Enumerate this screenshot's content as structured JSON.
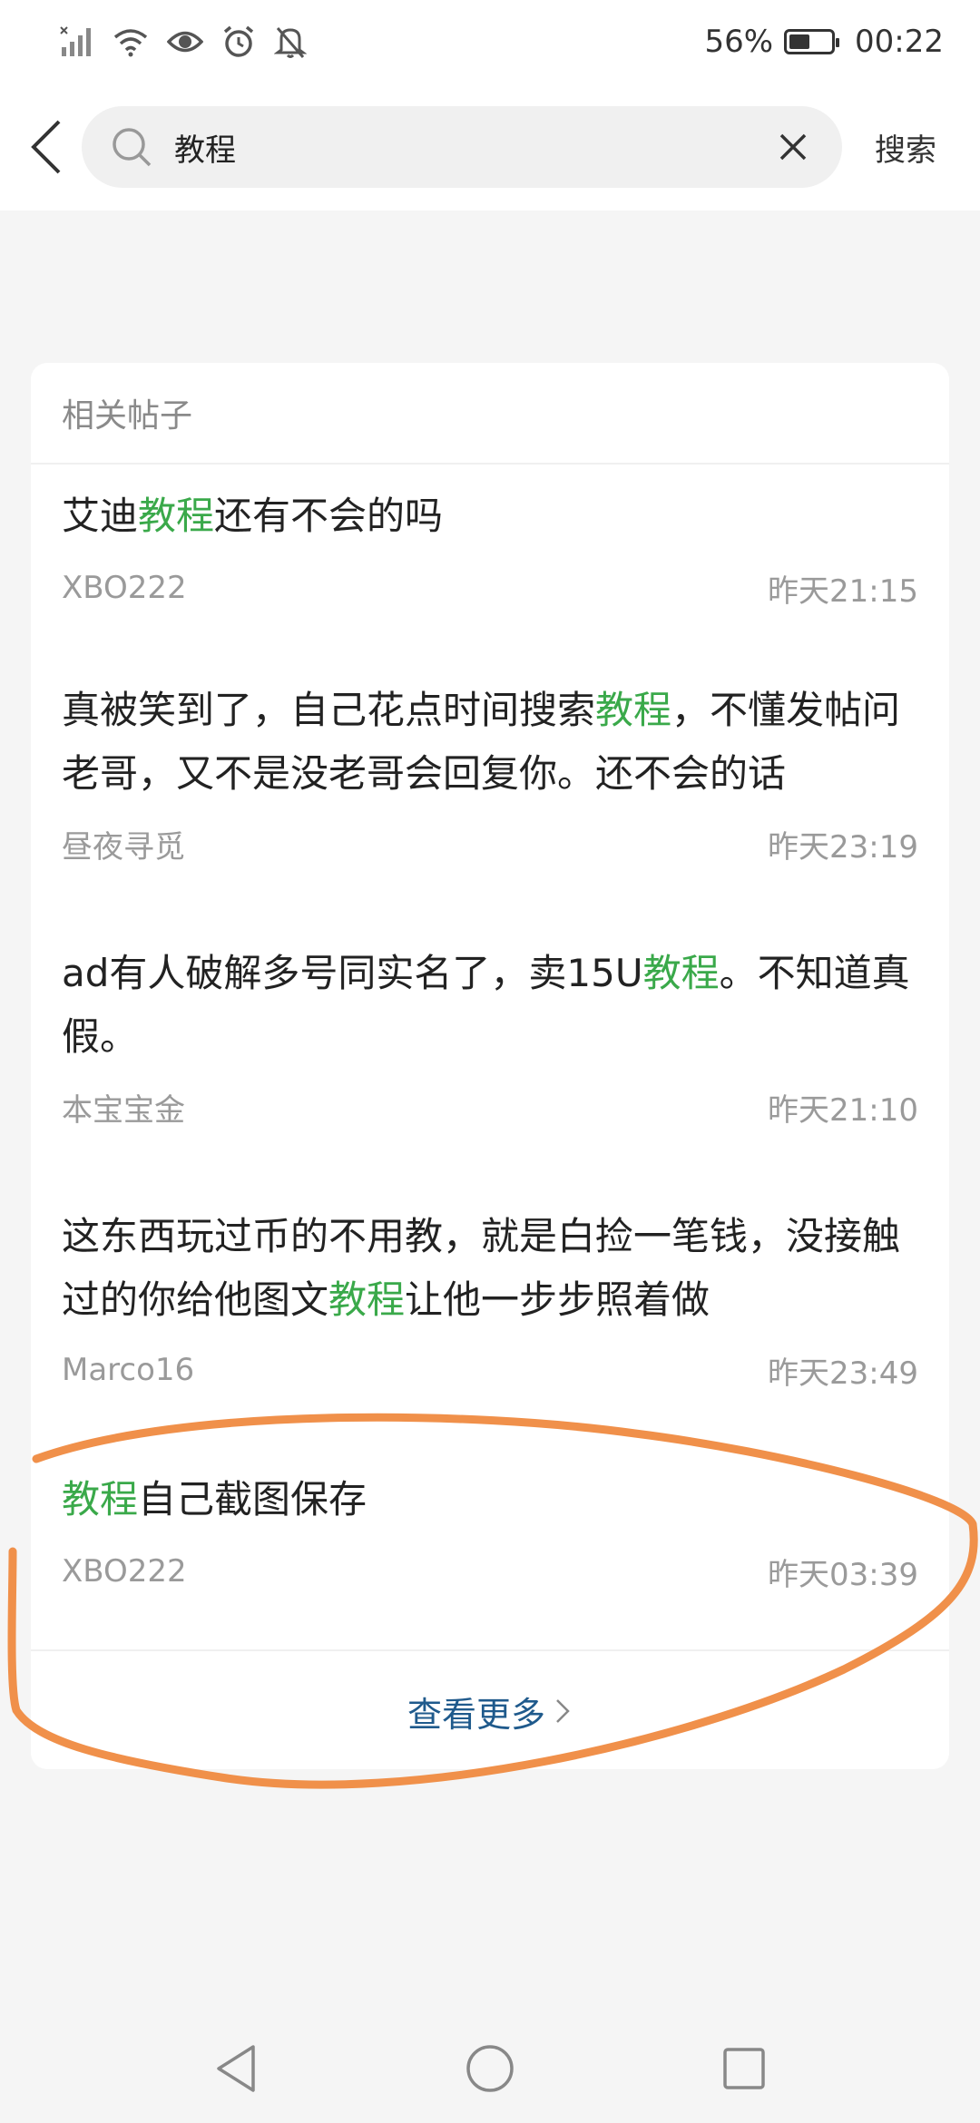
{
  "status_bar": {
    "battery_percent": "56%",
    "battery_level": 0.56,
    "time": "00:22",
    "icons": [
      "signal-icon",
      "wifi-icon",
      "eye-icon",
      "alarm-icon",
      "mute-icon"
    ]
  },
  "search": {
    "query": "教程",
    "search_label": "搜索"
  },
  "section": {
    "title": "相关帖子",
    "more_label": "查看更多"
  },
  "posts": [
    {
      "pre": "艾迪",
      "hl": "教程",
      "post": "还有不会的吗",
      "author": "XBO222",
      "time": "昨天21:15"
    },
    {
      "pre": "真被笑到了，自己花点时间搜索",
      "hl": "教程",
      "post": "，不懂发帖问老哥，又不是没老哥会回复你。还不会的话",
      "author": "昼夜寻觅",
      "time": "昨天23:19"
    },
    {
      "pre": "ad有人破解多号同实名了，卖15U",
      "hl": "教程",
      "post": "。不知道真假。",
      "author": "本宝宝金",
      "time": "昨天21:10"
    },
    {
      "pre": "这东西玩过币的不用教，就是白捡一笔钱，没接触过的你给他图文",
      "hl": "教程",
      "post": "让他一步步照着做",
      "author": "Marco16",
      "time": "昨天23:49"
    },
    {
      "pre": "",
      "hl": "教程",
      "post": "自己截图保存",
      "author": "XBO222",
      "time": "昨天03:39"
    }
  ],
  "colors": {
    "highlight": "#3aa94a",
    "link": "#1f5a8c",
    "annotation": "#f0904a"
  }
}
